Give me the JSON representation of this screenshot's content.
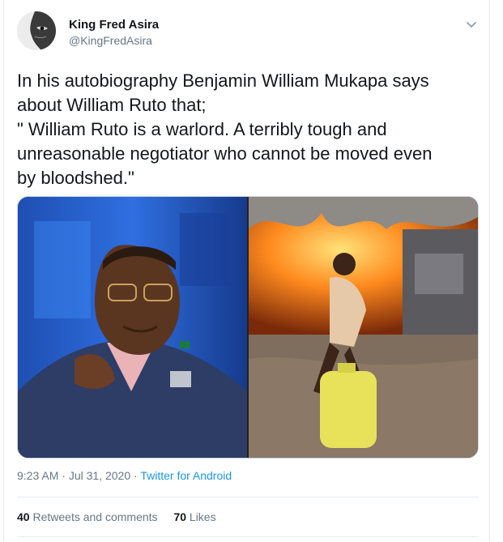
{
  "tweet": {
    "author_name": "King Fred Asira",
    "author_handle": "@KingFredAsira",
    "text_lines": [
      "In his autobiography Benjamin William Mukapa says",
      "about William Ruto that;",
      "\" William Ruto is a warlord. A terribly tough and",
      "unreasonable negotiator who cannot be moved even",
      "by bloodshed.\""
    ],
    "time": "9:23 AM",
    "separator": "·",
    "date": "Jul 31, 2020",
    "source": "Twitter for Android",
    "retweets_count": "40",
    "retweets_label": "Retweets and comments",
    "likes_count": "70",
    "likes_label": "Likes"
  },
  "icons": {
    "more": "chevron-down-icon",
    "avatar": "avatar"
  },
  "colors": {
    "link": "#1b95e0",
    "secondary_text": "#657786",
    "border": "#e6ecf0"
  }
}
